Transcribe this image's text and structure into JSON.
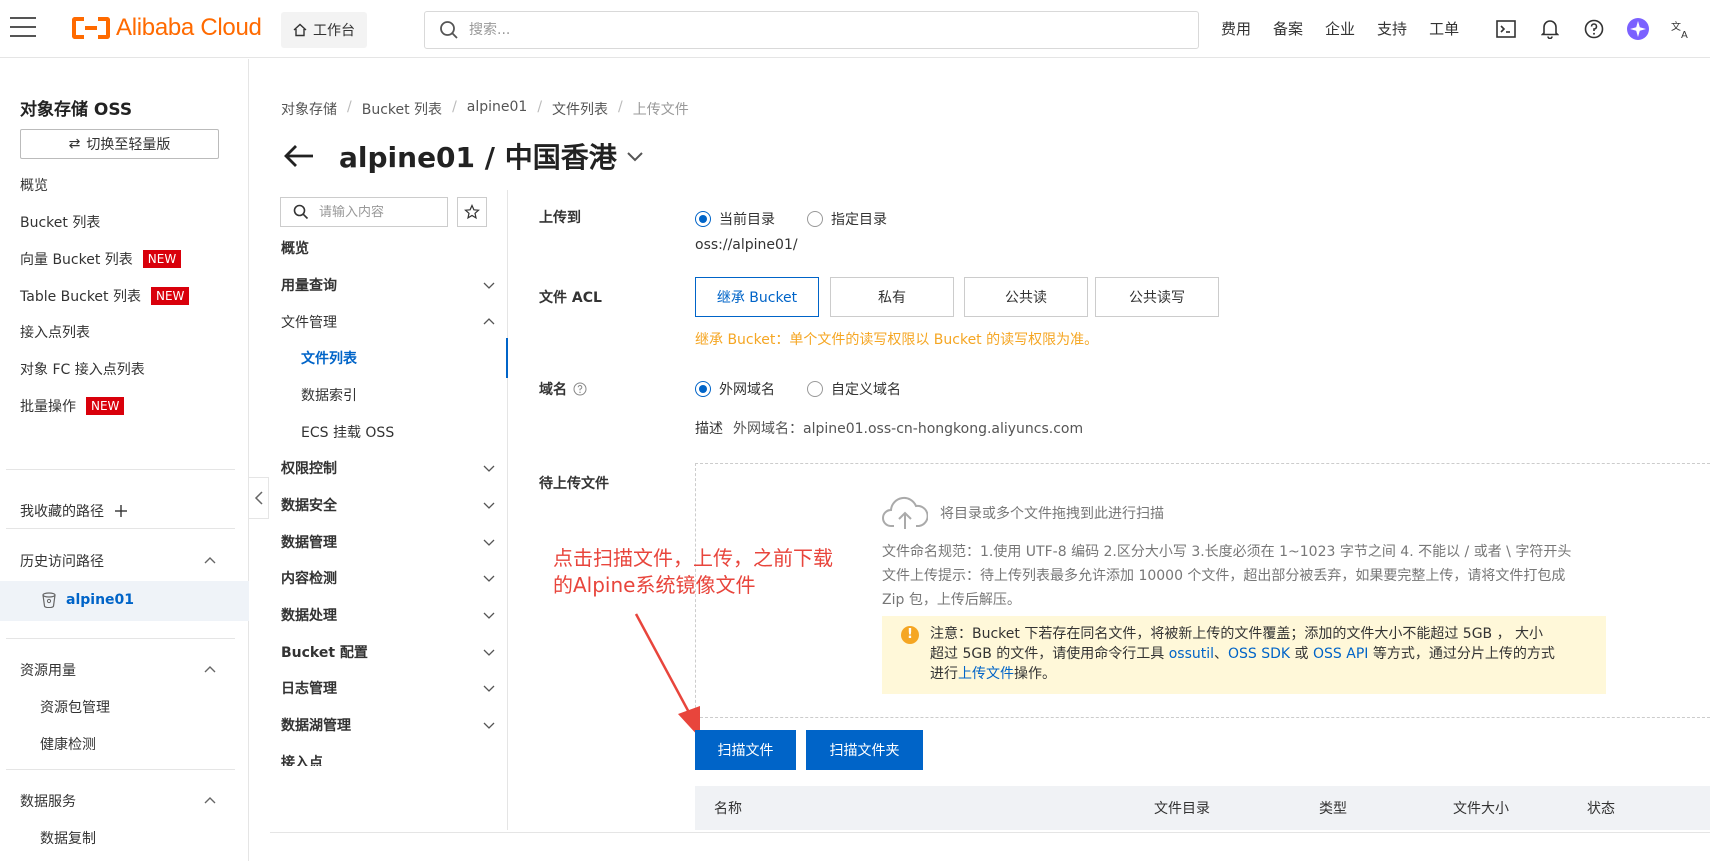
{
  "topbar": {
    "logo": "Alibaba Cloud",
    "workbench": "工作台",
    "search_placeholder": "搜索...",
    "links": [
      "费用",
      "备案",
      "企业",
      "支持",
      "工单"
    ]
  },
  "sidebar": {
    "title": "对象存储 OSS",
    "switch_label": "切换至轻量版",
    "items": [
      {
        "label": "概览"
      },
      {
        "label": "Bucket 列表"
      },
      {
        "label": "向量 Bucket 列表",
        "badge": "NEW"
      },
      {
        "label": "Table Bucket 列表",
        "badge": "NEW"
      },
      {
        "label": "接入点列表"
      },
      {
        "label": "对象 FC 接入点列表"
      },
      {
        "label": "批量操作",
        "badge": "NEW"
      }
    ],
    "favorites": "我收藏的路径",
    "history": "历史访问路径",
    "history_item": "alpine01",
    "resource_usage": "资源用量",
    "resource_items": [
      "资源包管理",
      "健康检测"
    ],
    "data_services": "数据服务",
    "data_service_items": [
      "数据复制"
    ]
  },
  "breadcrumb": [
    "对象存储",
    "Bucket 列表",
    "alpine01",
    "文件列表",
    "上传文件"
  ],
  "page_title": "alpine01 / 中国香港",
  "subnav": {
    "search_placeholder": "请输入内容",
    "overview": "概览",
    "usage": "用量查询",
    "file_mgmt": "文件管理",
    "file_list": "文件列表",
    "data_index": "数据索引",
    "ecs_mount": "ECS 挂载 OSS",
    "groups": [
      "权限控制",
      "数据安全",
      "数据管理",
      "内容检测",
      "数据处理",
      "Bucket 配置",
      "日志管理",
      "数据湖管理",
      "接入点"
    ]
  },
  "form": {
    "upload_to_label": "上传到",
    "upload_to_options": [
      "当前目录",
      "指定目录"
    ],
    "upload_path": "oss://alpine01/",
    "acl_label": "文件 ACL",
    "acl_options": [
      "继承 Bucket",
      "私有",
      "公共读",
      "公共读写"
    ],
    "acl_hint": "继承 Bucket：单个文件的读写权限以 Bucket 的读写权限为准。",
    "domain_label": "域名",
    "domain_options": [
      "外网域名",
      "自定义域名"
    ],
    "desc_key": "描述",
    "desc_value": "外网域名：alpine01.oss-cn-hongkong.aliyuncs.com",
    "pending_label": "待上传文件"
  },
  "dropzone": {
    "hint": "将目录或多个文件拖拽到此进行扫描",
    "rule1": "文件命名规范：1.使用 UTF-8 编码 2.区分大小写 3.长度必须在 1~1023 字节之间 4. 不能以 / 或者 \\ 字符开头",
    "rule2": "文件上传提示：待上传列表最多允许添加 10000 个文件，超出部分被丢弃，如果要完整上传，请将文件打包成",
    "rule3": "Zip 包，上传后解压。"
  },
  "notice": {
    "text1": "注意：Bucket 下若存在同名文件，将被新上传的文件覆盖；添加的文件大小不能超过 5GB ， 大小",
    "text2a": "超过 5GB 的文件，请使用命令行工具 ",
    "link_ossutil": "ossutil",
    "sep1": "、",
    "link_sdk": "OSS SDK",
    "sep2": " 或 ",
    "link_api": "OSS API",
    "text2b": " 等方式，通过分片上传的方式",
    "text3a": "进行",
    "link_upload": "上传文件",
    "text3b": "操作。"
  },
  "annotation": {
    "line1": "点击扫描文件，上传，之前下载",
    "line2": "的Alpine系统镜像文件"
  },
  "buttons": {
    "scan_files": "扫描文件",
    "scan_folder": "扫描文件夹"
  },
  "table": {
    "columns": [
      "名称",
      "文件目录",
      "类型",
      "文件大小",
      "状态"
    ]
  },
  "colors": {
    "brand": "#ff6a00",
    "primary": "#0064c8",
    "badge": "#d9000b",
    "hint": "#f5a623",
    "annotation": "#e8453c"
  }
}
